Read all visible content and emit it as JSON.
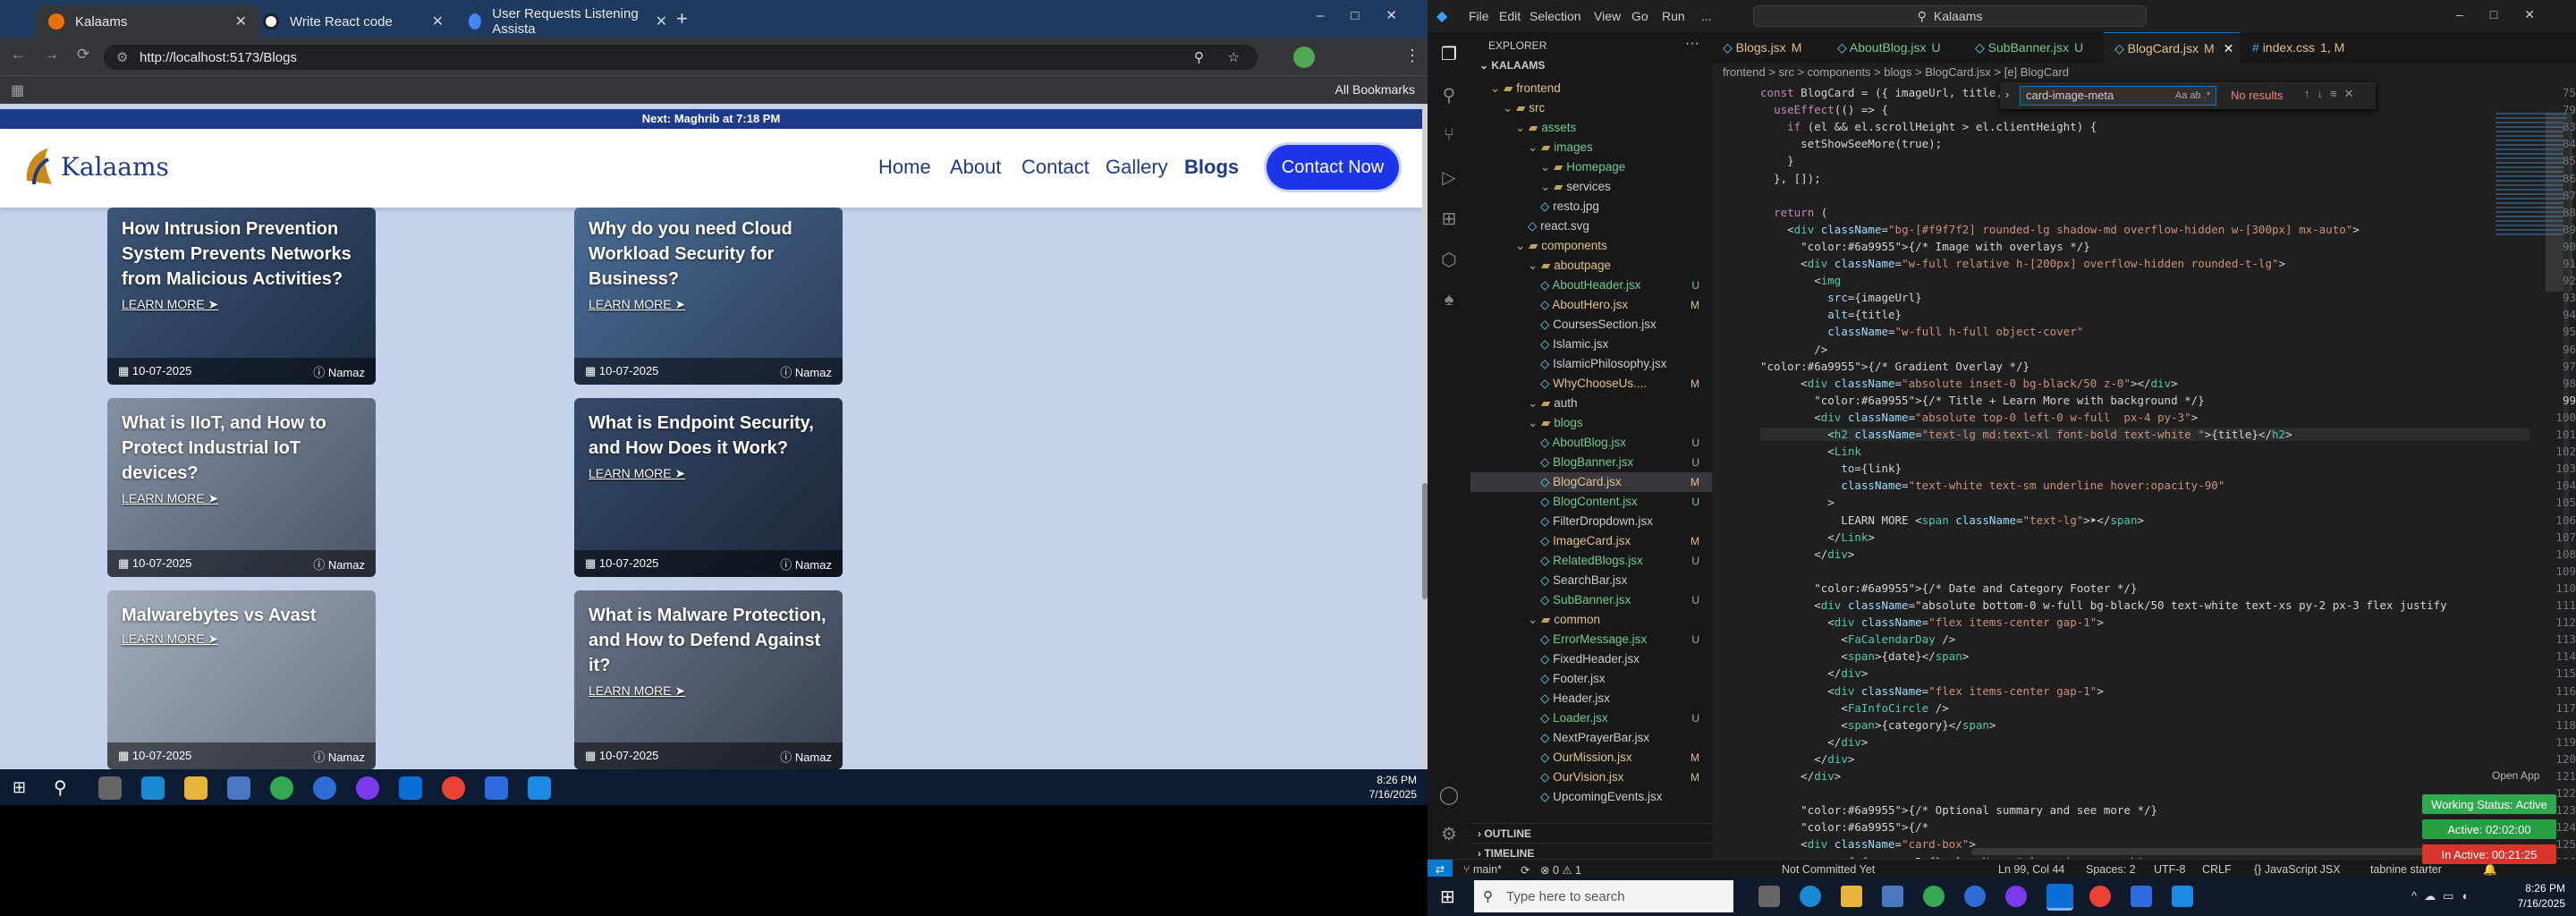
{
  "chrome": {
    "tabs": [
      {
        "title": "Kalaams",
        "active": true
      },
      {
        "title": "Write React code",
        "active": false
      },
      {
        "title": "User Requests Listening Assista",
        "active": false
      }
    ],
    "new_tab_symbol": "+",
    "url": "http://localhost:5173/Blogs",
    "all_bookmarks_label": "All Bookmarks"
  },
  "site": {
    "prayer_text": "Next: Maghrib at 7:18 PM",
    "logo_text": "Kalaams",
    "nav": [
      "Home",
      "About",
      "Contact",
      "Gallery",
      "Blogs"
    ],
    "contact_button": "Contact Now",
    "learn_more": "LEARN MORE ➤",
    "cards": [
      {
        "title": "How Intrusion Prevention System Prevents Networks from Malicious Activities?",
        "date": "10-07-2025",
        "category": "Namaz",
        "bg": "#314a66"
      },
      {
        "title": "Why do you need Cloud Workload Security for Business?",
        "date": "10-07-2025",
        "category": "Namaz",
        "bg": "#3f5b7e"
      },
      {
        "title": "What is IIoT, and How to Protect Industrial IoT devices?",
        "date": "10-07-2025",
        "category": "Namaz",
        "bg": "#6f7b8c"
      },
      {
        "title": "What is Endpoint Security, and How Does it Work?",
        "date": "10-07-2025",
        "category": "Namaz",
        "bg": "#2c3f5a"
      },
      {
        "title": "Malwarebytes vs Avast",
        "date": "10-07-2025",
        "category": "Namaz",
        "bg": "#8e98a6"
      },
      {
        "title": "What is Malware Protection, and How to Defend Against it?",
        "date": "10-07-2025",
        "category": "Namaz",
        "bg": "#5a6478"
      }
    ]
  },
  "taskbar_left": {
    "time": "8:26 PM",
    "date": "7/16/2025"
  },
  "vscode": {
    "menu": [
      "File",
      "Edit",
      "Selection",
      "View",
      "Go",
      "Run",
      "..."
    ],
    "search_box": "Kalaams",
    "explorer_title": "EXPLORER",
    "project": "KALAAMS",
    "tree": [
      {
        "name": "frontend",
        "depth": 1,
        "type": "folder",
        "badge": "",
        "color": "#e2c08d"
      },
      {
        "name": "src",
        "depth": 2,
        "type": "folder",
        "badge": "",
        "color": "#e2c08d"
      },
      {
        "name": "assets",
        "depth": 3,
        "type": "folder",
        "badge": "",
        "color": "#73c991"
      },
      {
        "name": "images",
        "depth": 4,
        "type": "folder",
        "badge": "",
        "color": "#73c991"
      },
      {
        "name": "Homepage",
        "depth": 5,
        "type": "folder",
        "badge": "",
        "color": "#73c991"
      },
      {
        "name": "services",
        "depth": 5,
        "type": "folder",
        "badge": "",
        "color": "#cccccc"
      },
      {
        "name": "resto.jpg",
        "depth": 5,
        "type": "file",
        "badge": "",
        "color": "#cccccc"
      },
      {
        "name": "react.svg",
        "depth": 4,
        "type": "file",
        "badge": "",
        "color": "#cccccc"
      },
      {
        "name": "components",
        "depth": 3,
        "type": "folder",
        "badge": "",
        "color": "#e2c08d"
      },
      {
        "name": "aboutpage",
        "depth": 4,
        "type": "folder",
        "badge": "",
        "color": "#e2c08d"
      },
      {
        "name": "AboutHeader.jsx",
        "depth": 5,
        "type": "file",
        "badge": "U",
        "color": "#73c991"
      },
      {
        "name": "AboutHero.jsx",
        "depth": 5,
        "type": "file",
        "badge": "M",
        "color": "#e2c08d"
      },
      {
        "name": "CoursesSection.jsx",
        "depth": 5,
        "type": "file",
        "badge": "",
        "color": "#cccccc"
      },
      {
        "name": "Islamic.jsx",
        "depth": 5,
        "type": "file",
        "badge": "",
        "color": "#cccccc"
      },
      {
        "name": "IslamicPhilosophy.jsx",
        "depth": 5,
        "type": "file",
        "badge": "",
        "color": "#cccccc"
      },
      {
        "name": "WhyChooseUs....",
        "depth": 5,
        "type": "file",
        "badge": "M",
        "color": "#e2c08d"
      },
      {
        "name": "auth",
        "depth": 4,
        "type": "folder",
        "badge": "",
        "color": "#cccccc"
      },
      {
        "name": "blogs",
        "depth": 4,
        "type": "folder",
        "badge": "",
        "color": "#73c991"
      },
      {
        "name": "AboutBlog.jsx",
        "depth": 5,
        "type": "file",
        "badge": "U",
        "color": "#73c991"
      },
      {
        "name": "BlogBanner.jsx",
        "depth": 5,
        "type": "file",
        "badge": "U",
        "color": "#73c991"
      },
      {
        "name": "BlogCard.jsx",
        "depth": 5,
        "type": "file",
        "badge": "M",
        "color": "#e2c08d",
        "selected": true
      },
      {
        "name": "BlogContent.jsx",
        "depth": 5,
        "type": "file",
        "badge": "U",
        "color": "#73c991"
      },
      {
        "name": "FilterDropdown.jsx",
        "depth": 5,
        "type": "file",
        "badge": "",
        "color": "#cccccc"
      },
      {
        "name": "ImageCard.jsx",
        "depth": 5,
        "type": "file",
        "badge": "M",
        "color": "#e2c08d"
      },
      {
        "name": "RelatedBlogs.jsx",
        "depth": 5,
        "type": "file",
        "badge": "U",
        "color": "#73c991"
      },
      {
        "name": "SearchBar.jsx",
        "depth": 5,
        "type": "file",
        "badge": "",
        "color": "#cccccc"
      },
      {
        "name": "SubBanner.jsx",
        "depth": 5,
        "type": "file",
        "badge": "U",
        "color": "#73c991"
      },
      {
        "name": "common",
        "depth": 4,
        "type": "folder",
        "badge": "",
        "color": "#e2c08d"
      },
      {
        "name": "ErrorMessage.jsx",
        "depth": 5,
        "type": "file",
        "badge": "U",
        "color": "#73c991"
      },
      {
        "name": "FixedHeader.jsx",
        "depth": 5,
        "type": "file",
        "badge": "",
        "color": "#cccccc"
      },
      {
        "name": "Footer.jsx",
        "depth": 5,
        "type": "file",
        "badge": "",
        "color": "#cccccc"
      },
      {
        "name": "Header.jsx",
        "depth": 5,
        "type": "file",
        "badge": "",
        "color": "#cccccc"
      },
      {
        "name": "Loader.jsx",
        "depth": 5,
        "type": "file",
        "badge": "U",
        "color": "#73c991"
      },
      {
        "name": "NextPrayerBar.jsx",
        "depth": 5,
        "type": "file",
        "badge": "",
        "color": "#cccccc"
      },
      {
        "name": "OurMission.jsx",
        "depth": 5,
        "type": "file",
        "badge": "M",
        "color": "#e2c08d"
      },
      {
        "name": "OurVision.jsx",
        "depth": 5,
        "type": "file",
        "badge": "M",
        "color": "#e2c08d"
      },
      {
        "name": "UpcomingEvents.jsx",
        "depth": 5,
        "type": "file",
        "badge": "",
        "color": "#cccccc"
      }
    ],
    "outline_label": "OUTLINE",
    "timeline_label": "TIMELINE",
    "editor_tabs": [
      {
        "name": "Blogs.jsx",
        "badge": "M",
        "color": "#e2c08d"
      },
      {
        "name": "AboutBlog.jsx",
        "badge": "U",
        "color": "#73c991"
      },
      {
        "name": "SubBanner.jsx",
        "badge": "U",
        "color": "#73c991"
      },
      {
        "name": "BlogCard.jsx",
        "badge": "M",
        "color": "#e2c08d",
        "active": true
      },
      {
        "name": "index.css",
        "badge": "1, M",
        "color": "#e2c08d"
      }
    ],
    "breadcrumb": "frontend > src > components > blogs > BlogCard.jsx > [e] BlogCard",
    "find": {
      "query": "card-image-meta",
      "result": "No results"
    },
    "code_lines": [
      {
        "n": "75",
        "t": "const BlogCard = ({ imageUrl, title, date, category"
      },
      {
        "n": "79",
        "t": "  useEffect(() => {"
      },
      {
        "n": "83",
        "t": "    if (el && el.scrollHeight > el.clientHeight) {"
      },
      {
        "n": "84",
        "t": "      setShowSeeMore(true);"
      },
      {
        "n": "85",
        "t": "    }"
      },
      {
        "n": "86",
        "t": "  }, []);"
      },
      {
        "n": "87",
        "t": ""
      },
      {
        "n": "88",
        "t": "  return ("
      },
      {
        "n": "89",
        "t": "    <div className=\"bg-[#f9f7f2] rounded-lg shadow-md overflow-hidden w-[300px] mx-auto\">"
      },
      {
        "n": "90",
        "t": "      {/* Image with overlays */}"
      },
      {
        "n": "91",
        "t": "      <div className=\"w-full relative h-[200px] overflow-hidden rounded-t-lg\">"
      },
      {
        "n": "92",
        "t": "        <img"
      },
      {
        "n": "93",
        "t": "          src={imageUrl}"
      },
      {
        "n": "94",
        "t": "          alt={title}"
      },
      {
        "n": "95",
        "t": "          className=\"w-full h-full object-cover\""
      },
      {
        "n": "96",
        "t": "        />"
      },
      {
        "n": "97",
        "t": "{/* Gradient Overlay */}"
      },
      {
        "n": "98",
        "t": "      <div className=\"absolute inset-0 bg-black/50 z-0\"></div>"
      },
      {
        "n": "99",
        "t": "        {/* Title + Learn More with background */}"
      },
      {
        "n": "100",
        "t": "        <div className=\"absolute top-0 left-0 w-full  px-4 py-3\">"
      },
      {
        "n": "101",
        "t": "          <h2 className=\"text-lg md:text-xl font-bold text-white \">{title}</h2>"
      },
      {
        "n": "102",
        "t": "          <Link"
      },
      {
        "n": "103",
        "t": "            to={link}"
      },
      {
        "n": "104",
        "t": "            className=\"text-white text-sm underline hover:opacity-90\""
      },
      {
        "n": "105",
        "t": "          >"
      },
      {
        "n": "106",
        "t": "            LEARN MORE <span className=\"text-lg\">➤</span>"
      },
      {
        "n": "107",
        "t": "          </Link>"
      },
      {
        "n": "108",
        "t": "        </div>"
      },
      {
        "n": "109",
        "t": ""
      },
      {
        "n": "110",
        "t": "        {/* Date and Category Footer */}"
      },
      {
        "n": "111",
        "t": "        <div className=\"absolute bottom-0 w-full bg-black/50 text-white text-xs py-2 px-3 flex justify"
      },
      {
        "n": "112",
        "t": "          <div className=\"flex items-center gap-1\">"
      },
      {
        "n": "113",
        "t": "            <FaCalendarDay />"
      },
      {
        "n": "114",
        "t": "            <span>{date}</span>"
      },
      {
        "n": "115",
        "t": "          </div>"
      },
      {
        "n": "116",
        "t": "          <div className=\"flex items-center gap-1\">"
      },
      {
        "n": "117",
        "t": "            <FaInfoCircle />"
      },
      {
        "n": "118",
        "t": "            <span>{category}</span>"
      },
      {
        "n": "119",
        "t": "          </div>"
      },
      {
        "n": "120",
        "t": "        </div>"
      },
      {
        "n": "121",
        "t": "      </div>"
      },
      {
        "n": "122",
        "t": ""
      },
      {
        "n": "123",
        "t": "      {/* Optional summary and see more */}"
      },
      {
        "n": "124",
        "t": "      {/*"
      },
      {
        "n": "125",
        "t": "      <div className=\"card-box\">"
      },
      {
        "n": "126",
        "t": "        <p ref={summaryRef} className=\"clamped-paragraph\""
      }
    ],
    "open_app": "Open App",
    "working_status": "Working Status: Active",
    "active_time": "Active: 02:02:00",
    "inactive_time": "In Active: 00:21:25",
    "status": {
      "branch": "main*",
      "sync": "⟳",
      "problems": "⊗ 0 ⚠ 1",
      "committed": "Not Committed Yet",
      "position": "Ln 99, Col 44",
      "spaces": "Spaces: 2",
      "encoding": "UTF-8",
      "eol": "CRLF",
      "language": "{} JavaScript JSX",
      "tabnine": "tabnine starter"
    }
  },
  "taskbar_right": {
    "search_placeholder": "Type here to search",
    "time": "8:26 PM",
    "date": "7/16/2025"
  }
}
